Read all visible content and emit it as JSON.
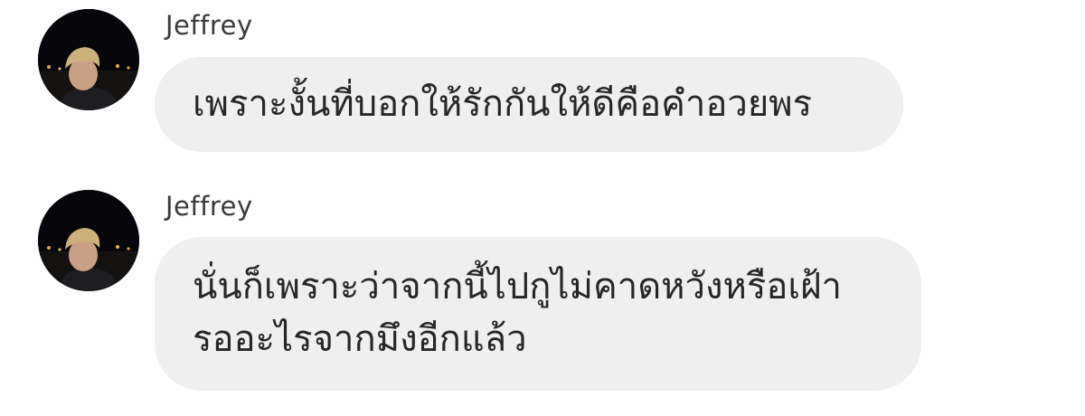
{
  "messages": [
    {
      "sender": "Jeffrey",
      "avatar": "profile-photo",
      "text": "เพราะงั้นที่บอกให้รักกันให้ดีคือคำอวยพร"
    },
    {
      "sender": "Jeffrey",
      "avatar": "profile-photo",
      "text": "นั่นก็เพราะว่าจากนี้ไปกูไม่คาดหวังหรือเฝ้า\nรออะไรจากมึงอีกแล้ว"
    }
  ],
  "colors": {
    "bubble_background": "#efefef",
    "message_text": "#262626",
    "sender_text": "#3a3a3a",
    "page_background": "#ffffff"
  }
}
